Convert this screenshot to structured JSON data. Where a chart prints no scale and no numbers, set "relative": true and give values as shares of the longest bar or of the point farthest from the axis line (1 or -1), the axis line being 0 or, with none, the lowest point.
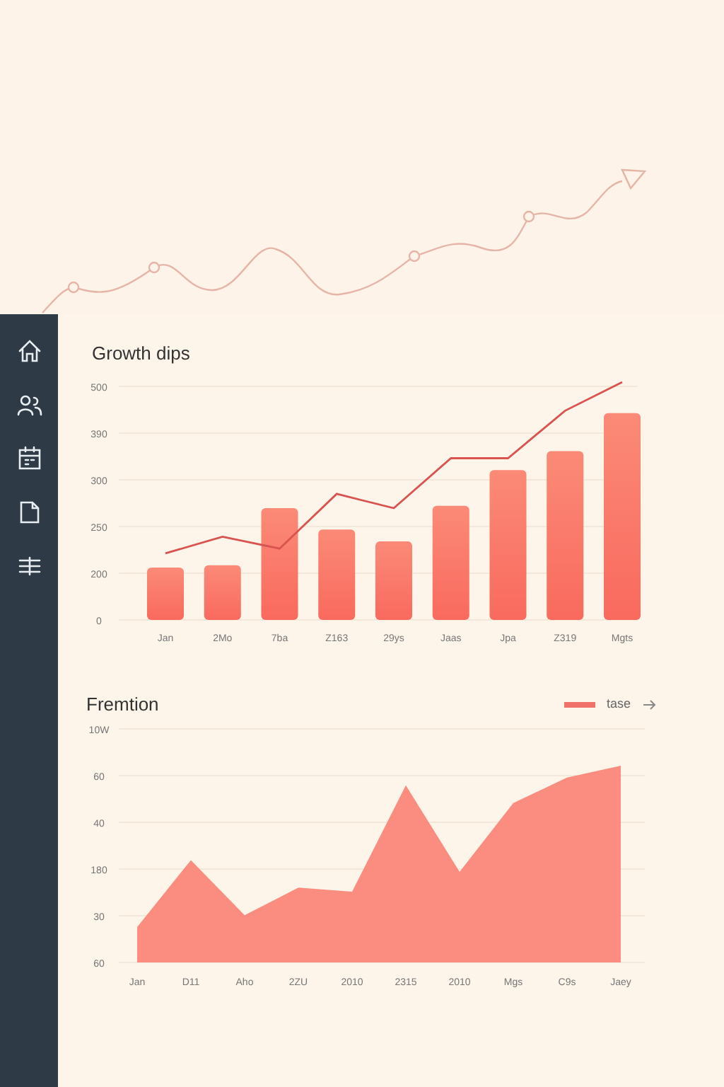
{
  "sidebar": {
    "items": [
      {
        "kind": "home"
      },
      {
        "kind": "people"
      },
      {
        "kind": "calendar"
      },
      {
        "kind": "document"
      },
      {
        "kind": "list"
      }
    ]
  },
  "growth_panel": {
    "title": "Growth dips",
    "y_axis_labels": [
      "500",
      "390",
      "300",
      "250",
      "200",
      "0"
    ],
    "chart_data": {
      "type": "bar",
      "categories": [
        "Jan",
        "2Mo",
        "7ba",
        "Z163",
        "29ys",
        "Jaas",
        "Jpa",
        "Z319",
        "Mgts"
      ],
      "relative": true,
      "series": [
        {
          "color": "#f96a5e",
          "values": [
            0.22,
            0.23,
            0.47,
            0.38,
            0.33,
            0.48,
            0.63,
            0.71,
            0.87
          ]
        },
        {
          "type": "line",
          "color": "#d9534f",
          "values": [
            0.28,
            0.35,
            0.3,
            0.53,
            0.47,
            0.68,
            0.68,
            0.88,
            1.0
          ]
        }
      ]
    }
  },
  "trend_panel": {
    "title": "Fremtion",
    "legend": {
      "label": "tase",
      "color": "#f0716a"
    },
    "y_axis_labels": [
      "10W",
      "60",
      "40",
      "180",
      "30",
      "60"
    ],
    "chart_data": {
      "type": "area",
      "categories": [
        "Jan",
        "D11",
        "Aho",
        "2ZU",
        "2010",
        "2315",
        "2010",
        "Mgs",
        "C9s",
        "Jaey"
      ],
      "relative": true,
      "series": [
        {
          "color": "#fa8c80",
          "values": [
            0.18,
            0.52,
            0.24,
            0.38,
            0.36,
            0.9,
            0.46,
            0.81,
            0.94,
            1.0
          ]
        }
      ]
    }
  }
}
